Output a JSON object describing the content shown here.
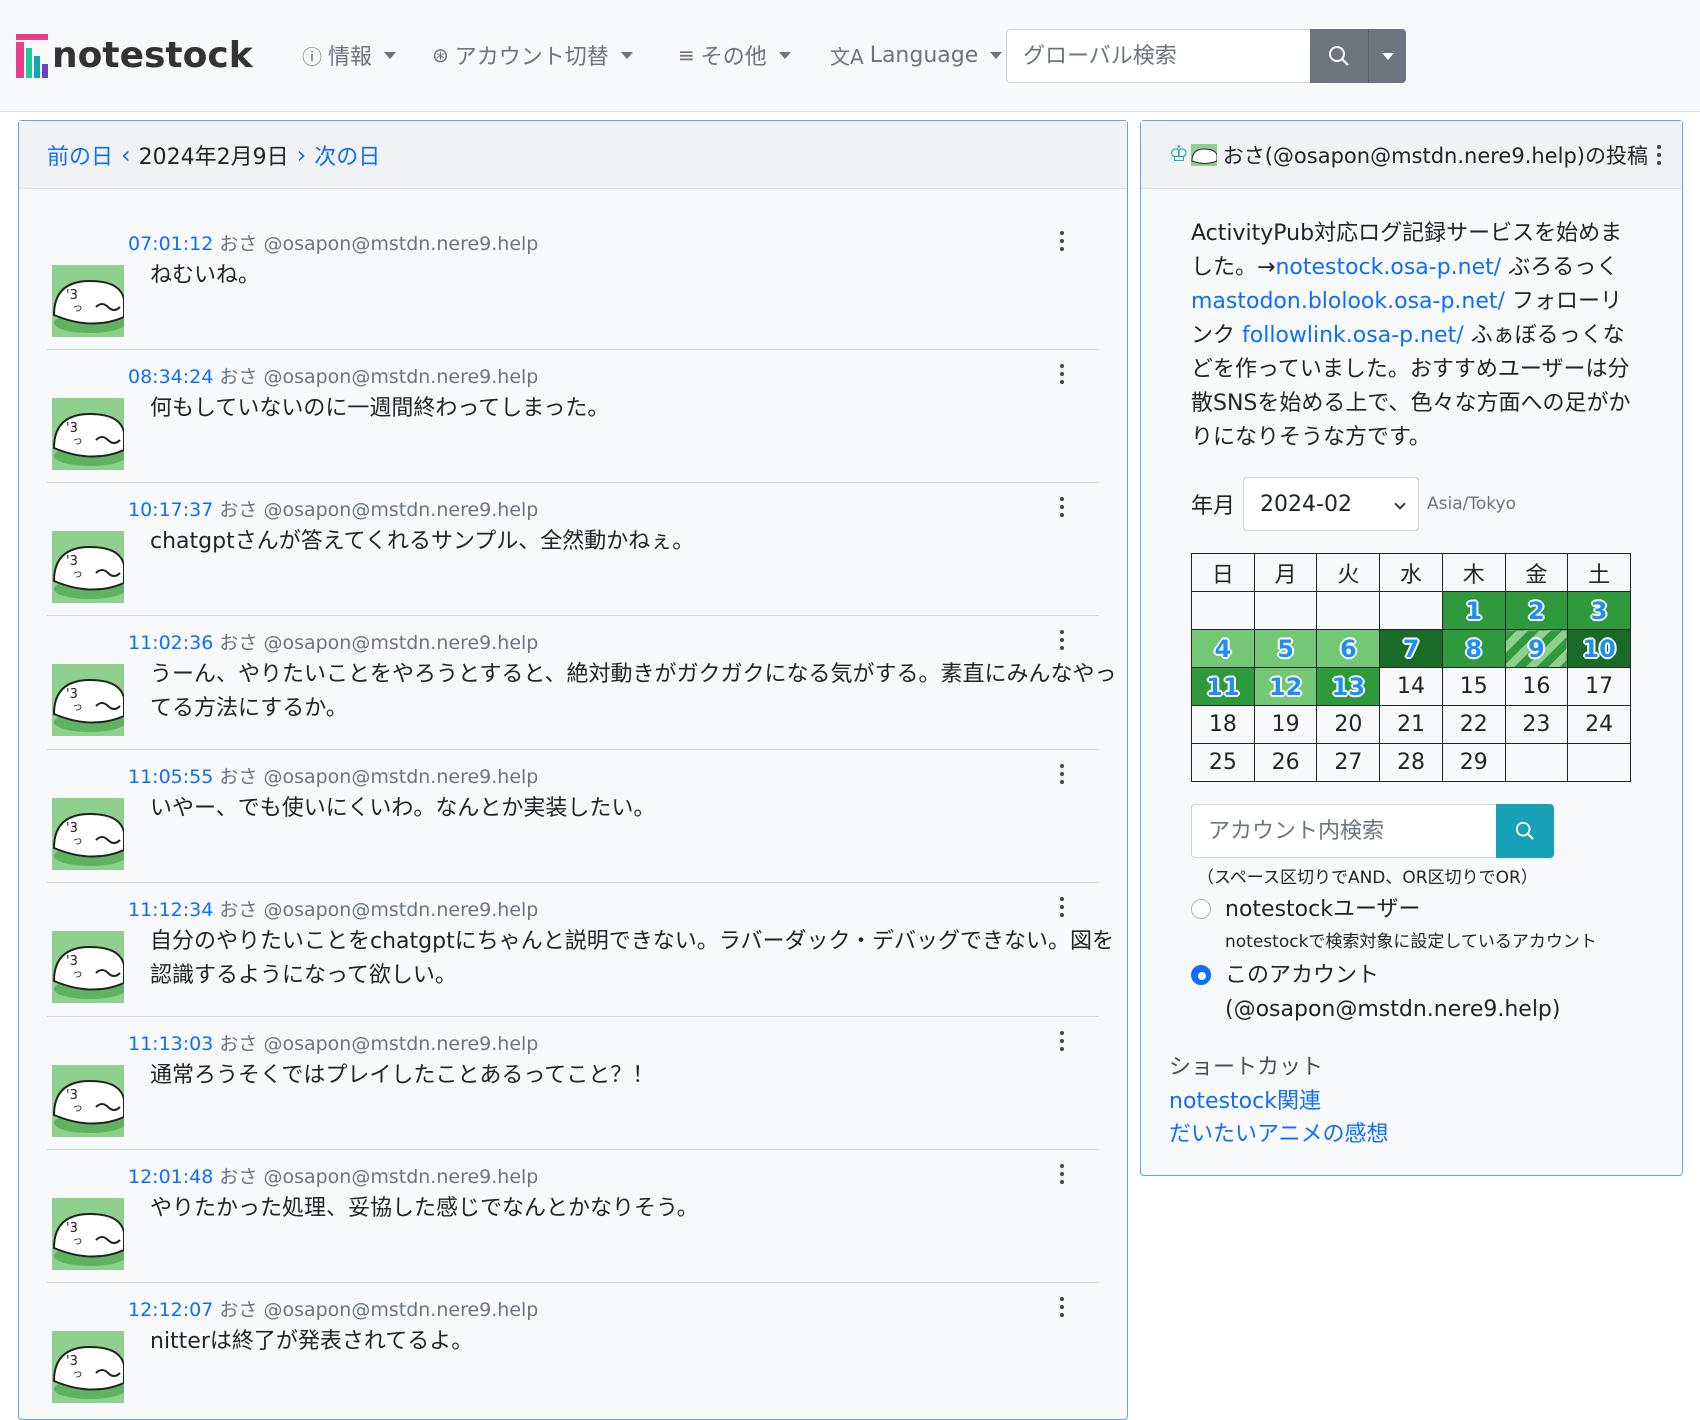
{
  "brand": {
    "name": "notestock"
  },
  "nav": {
    "info": "情報",
    "account_switch": "アカウント切替",
    "other": "その他",
    "language": "Language",
    "search_placeholder": "グローバル検索"
  },
  "daynav": {
    "prev": "前の日",
    "current": "2024年2月9日",
    "next": "次の日"
  },
  "posts": [
    {
      "time": "07:01:12",
      "name": "おさ",
      "handle": "@osapon@mstdn.nere9.help",
      "text": "ねむいね。"
    },
    {
      "time": "08:34:24",
      "name": "おさ",
      "handle": "@osapon@mstdn.nere9.help",
      "text": "何もしていないのに一週間終わってしまった。"
    },
    {
      "time": "10:17:37",
      "name": "おさ",
      "handle": "@osapon@mstdn.nere9.help",
      "text": "chatgptさんが答えてくれるサンプル、全然動かねぇ。"
    },
    {
      "time": "11:02:36",
      "name": "おさ",
      "handle": "@osapon@mstdn.nere9.help",
      "text": "うーん、やりたいことをやろうとすると、絶対動きがガクガクになる気がする。素直にみんなやってる方法にするか。"
    },
    {
      "time": "11:05:55",
      "name": "おさ",
      "handle": "@osapon@mstdn.nere9.help",
      "text": "いやー、でも使いにくいわ。なんとか実装したい。"
    },
    {
      "time": "11:12:34",
      "name": "おさ",
      "handle": "@osapon@mstdn.nere9.help",
      "text": "自分のやりたいことをchatgptにちゃんと説明できない。ラバーダック・デバッグできない。図を認識するようになって欲しい。"
    },
    {
      "time": "11:13:03",
      "name": "おさ",
      "handle": "@osapon@mstdn.nere9.help",
      "text": "通常ろうそくではプレイしたことあるってこと？！"
    },
    {
      "time": "12:01:48",
      "name": "おさ",
      "handle": "@osapon@mstdn.nere9.help",
      "text": "やりたかった処理、妥協した感じでなんとかなりそう。"
    },
    {
      "time": "12:12:07",
      "name": "おさ",
      "handle": "@osapon@mstdn.nere9.help",
      "text": "nitterは終了が発表されてるよ。"
    }
  ],
  "profile": {
    "title": "おさ(@osapon@mstdn.nere9.help)の投稿",
    "bio_1": "ActivityPub対応ログ記録サービスを始めました。→",
    "bio_link1": "notestock.osa-p.net/",
    "bio_2": " ぶろるっく ",
    "bio_link2": "mastodon.blolook.osa-p.net/",
    "bio_3": " フォローリンク ",
    "bio_link3": "followlink.osa-p.net/",
    "bio_4": " ふぁぼるっくなどを作っていました。おすすめユーザーは分散SNSを始める上で、色々な方面への足がかりになりそうな方です。"
  },
  "calendar": {
    "label": "年月",
    "value": "2024-02",
    "tz": "Asia/Tokyo",
    "weekdays": [
      "日",
      "月",
      "火",
      "水",
      "木",
      "金",
      "土"
    ]
  },
  "account_search": {
    "placeholder": "アカウント内検索",
    "hint": "（スペース区切りでAND、OR区切りでOR）",
    "opt1": "notestockユーザー",
    "opt1_sub": "notestockで検索対象に設定しているアカウント",
    "opt2_line1": "このアカウント",
    "opt2_line2": "(@osapon@mstdn.nere9.help)"
  },
  "shortcuts": {
    "title": "ショートカット",
    "link1": "notestock関連",
    "link2": "だいたいアニメの感想"
  },
  "colors": {
    "accent": "#0d6efd",
    "card_border": "#5aa8e6",
    "search_btn": "#6c757d",
    "acct_btn": "#17a2b8"
  }
}
